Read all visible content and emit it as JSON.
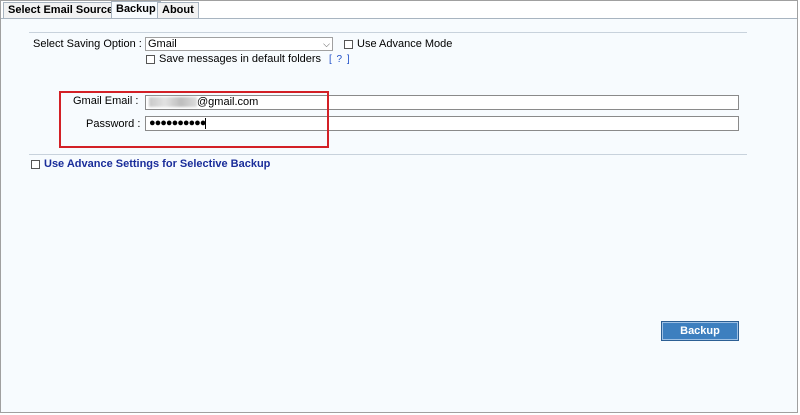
{
  "tabs": [
    {
      "label": "Select Email Source",
      "active": false
    },
    {
      "label": "Backup",
      "active": true
    },
    {
      "label": "About",
      "active": false
    }
  ],
  "saving": {
    "label": "Select Saving Option :",
    "value": "Gmail",
    "advance_mode_label": "Use Advance Mode",
    "default_folders_label": "Save messages in default folders",
    "help_label": "[ ? ]"
  },
  "credentials": {
    "email_label": "Gmail Email :",
    "email_value": "@gmail.com",
    "password_label": "Password :",
    "password_value": "●●●●●●●●●●"
  },
  "advanced_settings_label": "Use Advance Settings for Selective Backup",
  "backup_button_label": "Backup",
  "colors": {
    "accent_button": "#3d7fbf",
    "highlight_box": "#d32026",
    "link_text": "#1a2d9a"
  }
}
